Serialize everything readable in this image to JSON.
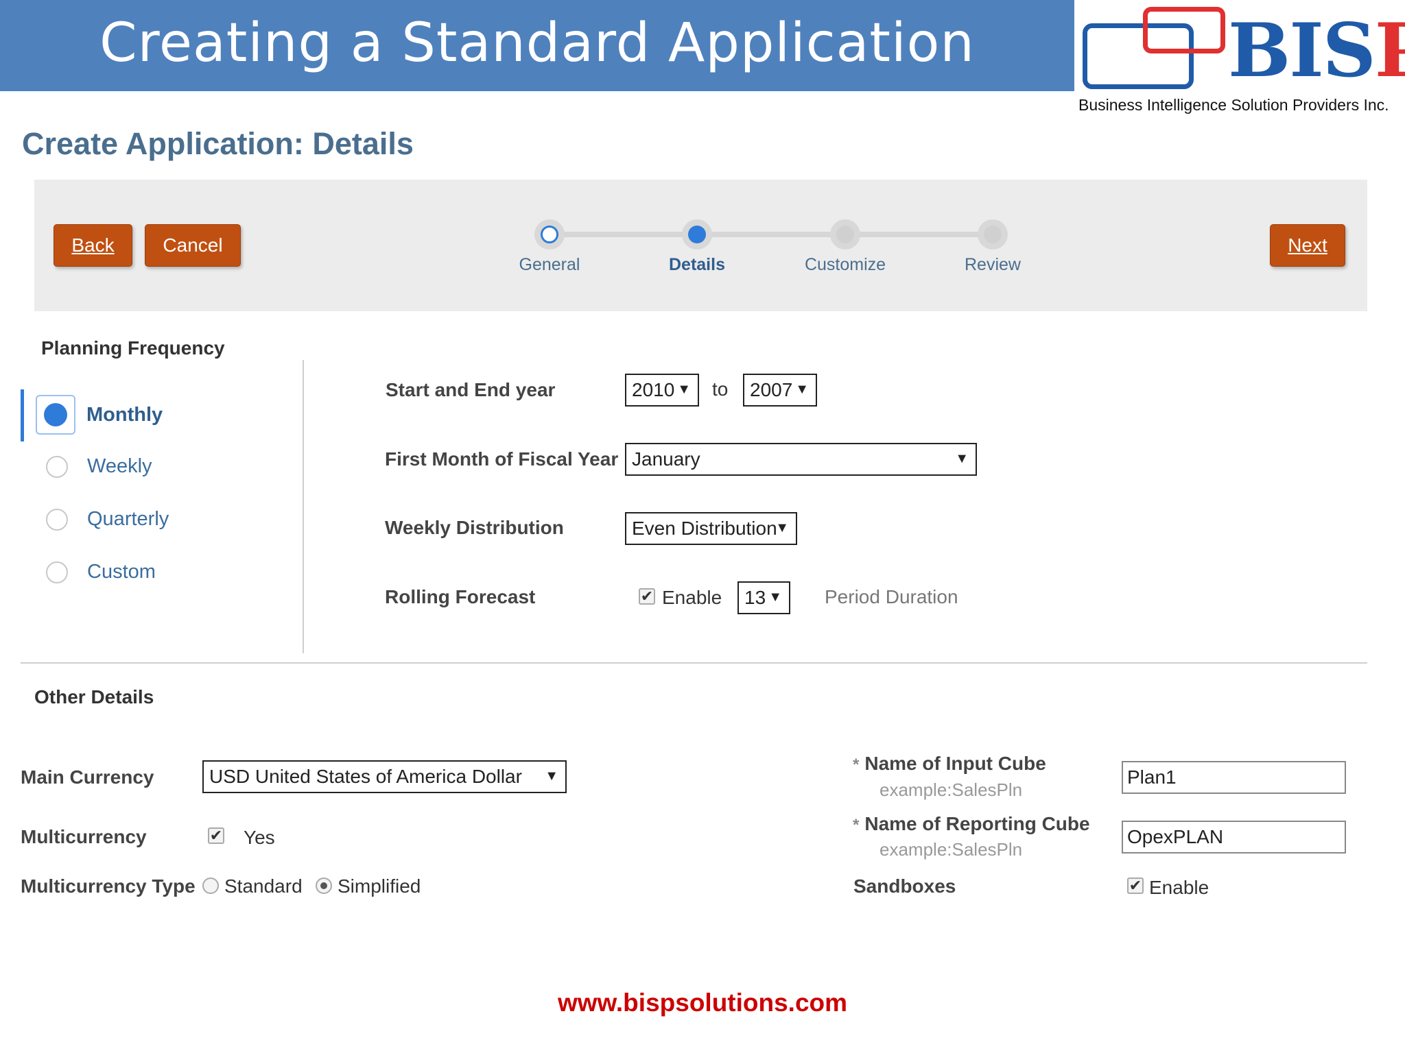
{
  "banner": {
    "title": "Creating a Standard Application"
  },
  "logo": {
    "brand_main": "BIS",
    "brand_accent": "P",
    "subtitle": "Business Intelligence Solution Providers Inc."
  },
  "page": {
    "title": "Create Application: Details"
  },
  "train": {
    "back_label": "Back",
    "cancel_label": "Cancel",
    "next_label": "Next",
    "steps": [
      {
        "label": "General",
        "state": "visited"
      },
      {
        "label": "Details",
        "state": "current"
      },
      {
        "label": "Customize",
        "state": "pending"
      },
      {
        "label": "Review",
        "state": "pending"
      }
    ]
  },
  "planning_frequency": {
    "heading": "Planning Frequency",
    "options": [
      {
        "label": "Monthly",
        "selected": true
      },
      {
        "label": "Weekly",
        "selected": false
      },
      {
        "label": "Quarterly",
        "selected": false
      },
      {
        "label": "Custom",
        "selected": false
      }
    ]
  },
  "details": {
    "start_end_label": "Start and End year",
    "start_year": "2010",
    "to_label": "to",
    "end_year": "2007",
    "fiscal_label": "First Month of Fiscal Year",
    "fiscal_value": "January",
    "weekly_label": "Weekly Distribution",
    "weekly_value": "Even Distribution",
    "rolling_label": "Rolling Forecast",
    "rolling_enable_label": "Enable",
    "rolling_enabled": true,
    "period_value": "13",
    "period_label": "Period Duration"
  },
  "other": {
    "heading": "Other Details",
    "currency_label": "Main Currency",
    "currency_value": "USD United States of America Dollar",
    "multicurrency_label": "Multicurrency",
    "multicurrency_yes": "Yes",
    "multicurrency_checked": true,
    "mc_type_label": "Multicurrency Type",
    "mc_type_standard": "Standard",
    "mc_type_simplified": "Simplified",
    "mc_type_selected": "Simplified",
    "input_cube_label": "Name of Input Cube",
    "input_cube_example": "example:SalesPln",
    "input_cube_value": "Plan1",
    "reporting_cube_label": "Name of Reporting Cube",
    "reporting_cube_example": "example:SalesPln",
    "reporting_cube_value": "OpexPLAN",
    "sandboxes_label": "Sandboxes",
    "sandboxes_enable": "Enable",
    "sandboxes_checked": true,
    "required_marker": "*"
  },
  "footer": {
    "url": "www.bispsolutions.com"
  },
  "icons": {
    "caret": "▼",
    "check": "✔"
  },
  "colors": {
    "banner": "#4f81bd",
    "button": "#c05011",
    "accent_blue": "#2f7bd9",
    "footer_red": "#cc0000"
  }
}
